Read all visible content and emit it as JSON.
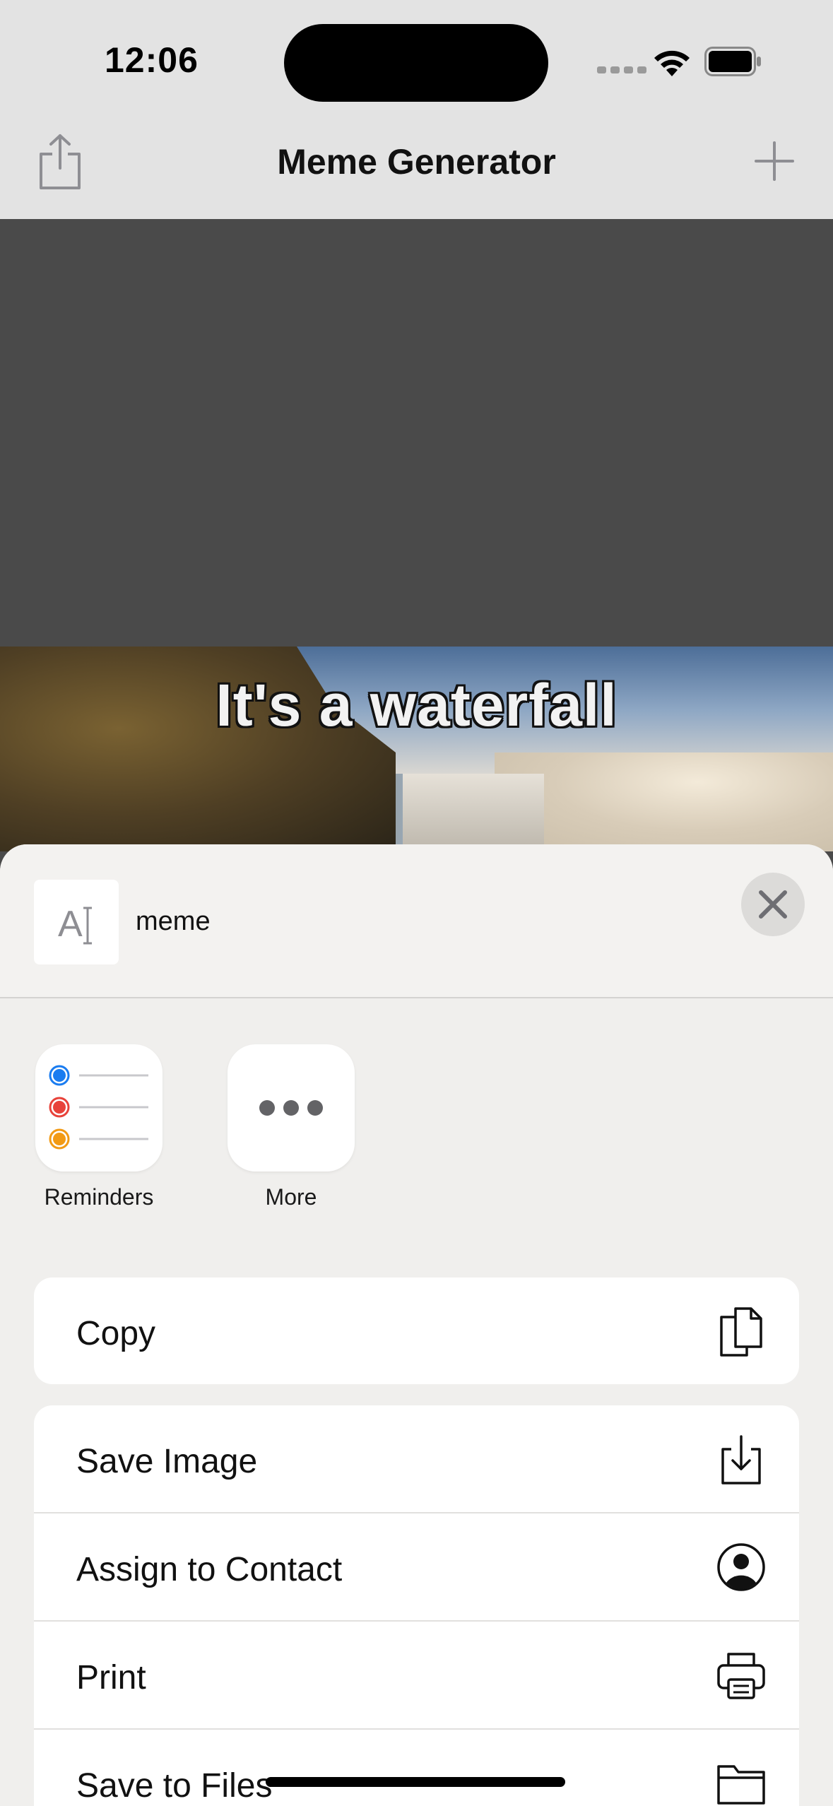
{
  "status_bar": {
    "time": "12:06"
  },
  "nav": {
    "title": "Meme Generator",
    "share_icon": "share-icon",
    "add_icon": "plus-icon"
  },
  "meme": {
    "caption": "It's a waterfall"
  },
  "share_sheet": {
    "preview_title": "meme",
    "close_icon": "close-icon",
    "apps": [
      {
        "label": "Reminders",
        "icon": "reminders-icon"
      },
      {
        "label": "More",
        "icon": "more-icon"
      }
    ],
    "actions_group1": [
      {
        "label": "Copy",
        "icon": "copy-icon"
      }
    ],
    "actions_group2": [
      {
        "label": "Save Image",
        "icon": "save-image-icon"
      },
      {
        "label": "Assign to Contact",
        "icon": "contact-icon"
      },
      {
        "label": "Print",
        "icon": "printer-icon"
      },
      {
        "label": "Save to Files",
        "icon": "folder-icon"
      }
    ]
  },
  "colors": {
    "bar_background": "#e3e3e3",
    "canvas_background": "#4a4a4a",
    "sheet_background": "#f0efed",
    "reminder_blue": "#1a7cf0",
    "reminder_red": "#e8423a",
    "reminder_orange": "#f29a14"
  }
}
